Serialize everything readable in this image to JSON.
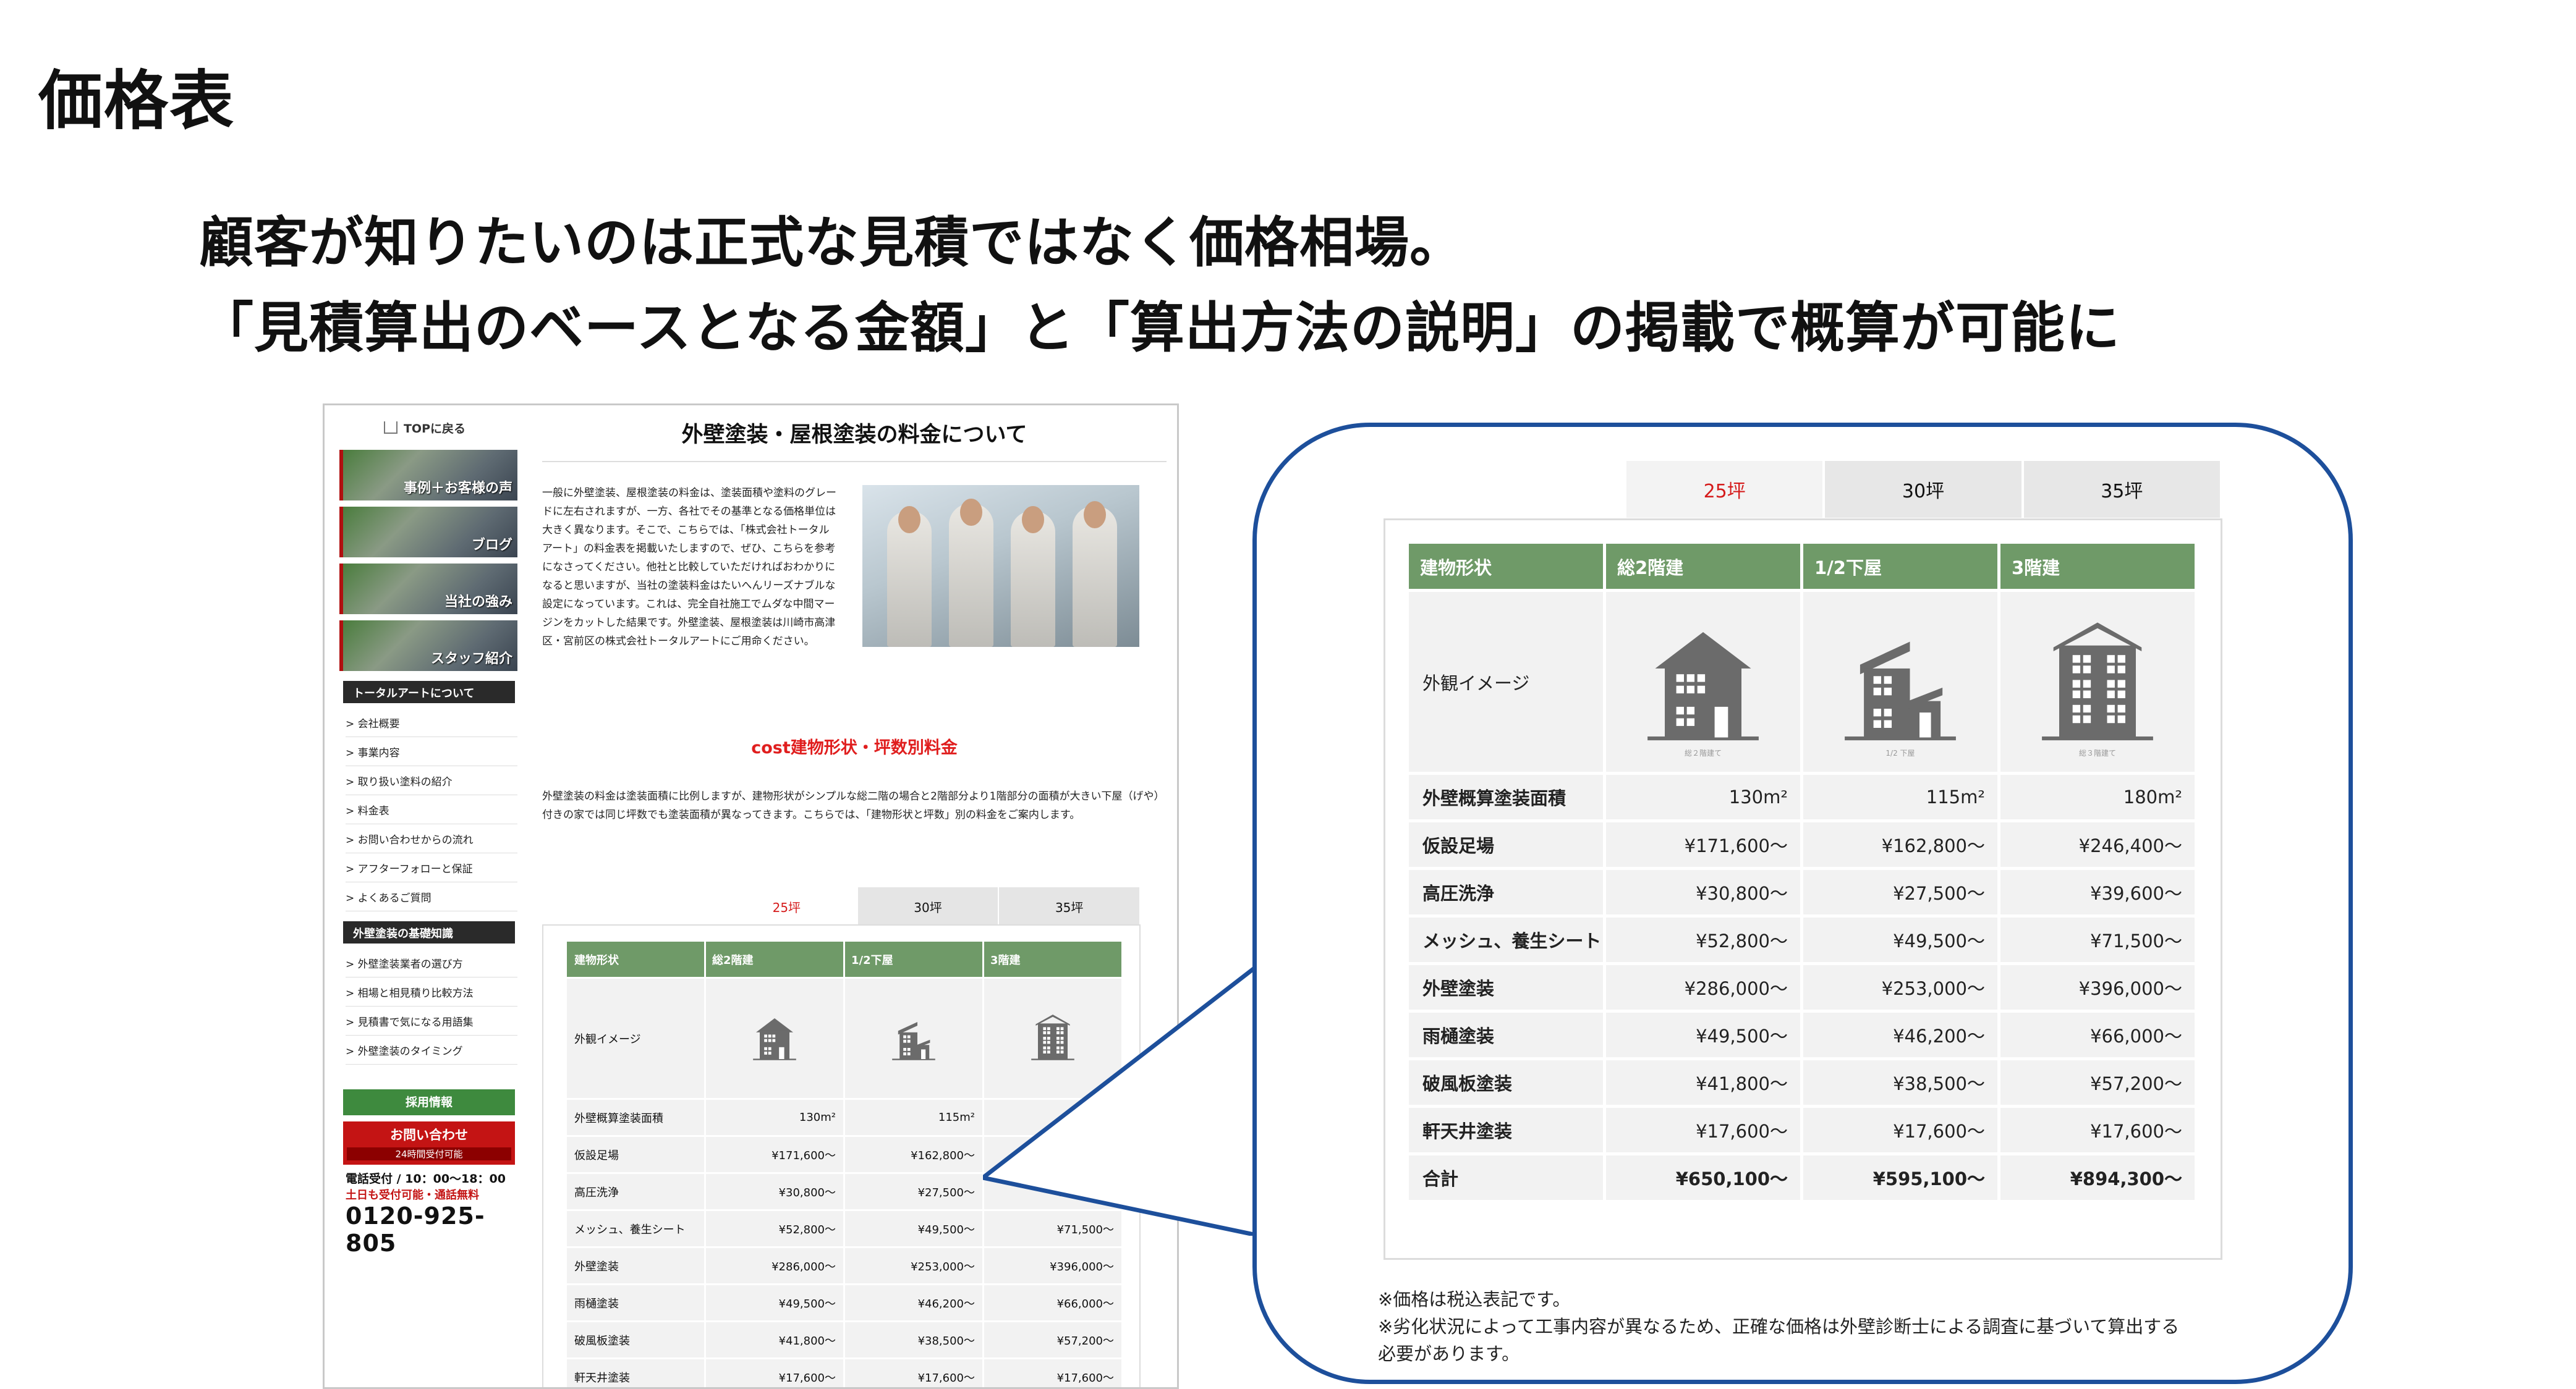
{
  "slide": {
    "title": "価格表",
    "lead1": "顧客が知りたいのは正式な見積ではなく価格相場。",
    "lead2": "「見積算出のベースとなる金額」と「算出方法の説明」の掲載で概算が可能に"
  },
  "website": {
    "top_back": "TOPに戻る",
    "banners": [
      "事例＋お客様の声",
      "ブログ",
      "当社の強み",
      "スタッフ紹介"
    ],
    "section1_title": "トータルアートについて",
    "section1_links": [
      "> 会社概要",
      "> 事業内容",
      "> 取り扱い塗料の紹介",
      "> 料金表",
      "> お問い合わせからの流れ",
      "> アフターフォローと保証",
      "> よくあるご質問"
    ],
    "section2_title": "外壁塗装の基礎知識",
    "section2_links": [
      "> 外壁塗装業者の選び方",
      "> 相場と相見積り比較方法",
      "> 見積書で気になる用語集",
      "> 外壁塗装のタイミング"
    ],
    "recruit": "採用情報",
    "contact_btn": "お問い合わせ",
    "contact_sub": "24時間受付可能",
    "phone_hours": "電話受付 / 10：00～18：00",
    "phone_note": "土日も受付可能・通話無料",
    "phone_number": "0120-925-805",
    "page_title": "外壁塗装・屋根塗装の料金について",
    "intro": "一般に外壁塗装、屋根塗装の料金は、塗装面積や塗料のグレードに左右されますが、一方、各社でその基準となる価格単位は大きく異なります。そこで、こちらでは、「株式会社トータルアート」の料金表を掲載いたしますので、ぜひ、こちらを参考になさってください。他社と比較していただければおわかりになると思いますが、当社の塗装料金はたいへんリーズナブルな設定になっています。これは、完全自社施工でムダな中間マージンをカットした結果です。外壁塗装、屋根塗装は川崎市高津区・宮前区の株式会社トータルアートにご用命ください。",
    "cost_title": "cost建物形状・坪数別料金",
    "cost_text": "外壁塗装の料金は塗装面積に比例しますが、建物形状がシンプルな総二階の場合と2階部分より1階部分の面積が大きい下屋（げや）付きの家では同じ坪数でも塗装面積が異なってきます。こちらでは、「建物形状と坪数」別の料金をご案内します。",
    "table_rows_visible": 9
  },
  "price_table": {
    "tabs": [
      "25坪",
      "30坪",
      "35坪"
    ],
    "active_tab": "25坪",
    "headers": [
      "建物形状",
      "総2階建",
      "1/2下屋",
      "3階建"
    ],
    "image_label": "外観イメージ",
    "image_captions": [
      "総２階建て",
      "1/2 下屋",
      "総３階建て"
    ],
    "area_label": "外壁概算塗装面積",
    "areas": [
      "130m²",
      "115m²",
      "180m²"
    ],
    "rows": [
      {
        "label": "仮設足場",
        "values": [
          "¥171,600～",
          "¥162,800～",
          "¥246,400～"
        ]
      },
      {
        "label": "高圧洗浄",
        "values": [
          "¥30,800～",
          "¥27,500～",
          "¥39,600～"
        ]
      },
      {
        "label": "メッシュ、養生シート",
        "values": [
          "¥52,800～",
          "¥49,500～",
          "¥71,500～"
        ]
      },
      {
        "label": "外壁塗装",
        "values": [
          "¥286,000～",
          "¥253,000～",
          "¥396,000～"
        ]
      },
      {
        "label": "雨樋塗装",
        "values": [
          "¥49,500～",
          "¥46,200～",
          "¥66,000～"
        ]
      },
      {
        "label": "破風板塗装",
        "values": [
          "¥41,800～",
          "¥38,500～",
          "¥57,200～"
        ]
      },
      {
        "label": "軒天井塗装",
        "values": [
          "¥17,600～",
          "¥17,600～",
          "¥17,600～"
        ]
      }
    ],
    "total_label": "合計",
    "totals": [
      "¥650,100～",
      "¥595,100～",
      "¥894,300～"
    ],
    "notes": [
      "※価格は税込表記です。",
      "※劣化状況によって工事内容が異なるため、正確な価格は外壁診断士による調査に基づいて算出する",
      "必要があります。"
    ],
    "colors": {
      "header_green": "#6f9a68",
      "active_tab_red": "#d51b1b",
      "bubble_border": "#1d4f9b",
      "house_gray": "#6b6b6b"
    }
  }
}
